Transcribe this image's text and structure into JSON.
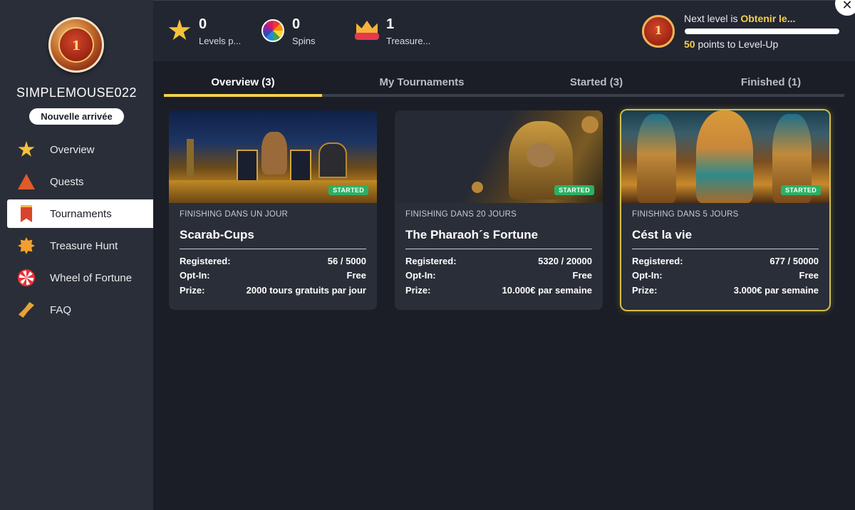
{
  "profile": {
    "avatar_level": "1",
    "username": "SIMPLEMOUSE022",
    "rank": "Nouvelle arrivée"
  },
  "nav": {
    "items": [
      {
        "label": "Overview",
        "icon": "star-icon"
      },
      {
        "label": "Quests",
        "icon": "quest-icon"
      },
      {
        "label": "Tournaments",
        "icon": "banner-icon",
        "active": true
      },
      {
        "label": "Treasure Hunt",
        "icon": "medal-icon"
      },
      {
        "label": "Wheel of Fortune",
        "icon": "wheel-icon"
      },
      {
        "label": "FAQ",
        "icon": "horn-icon"
      }
    ]
  },
  "stats": {
    "levels": {
      "value": "0",
      "label": "Levels p..."
    },
    "spins": {
      "value": "0",
      "label": "Spins"
    },
    "treasure": {
      "value": "1",
      "label": "Treasure..."
    }
  },
  "level": {
    "badge": "1",
    "next_prefix": "Next level is ",
    "next_name": "Obtenir le...",
    "progress_fraction": 0.0,
    "points": "50",
    "points_suffix": " points to Level-Up"
  },
  "close": {
    "glyph": "✕"
  },
  "tabs": [
    {
      "label": "Overview (3)",
      "active": true
    },
    {
      "label": "My Tournaments"
    },
    {
      "label": "Started (3)"
    },
    {
      "label": "Finished (1)"
    }
  ],
  "cards": [
    {
      "status": "STARTED",
      "subtitle": "FINISHING DANS UN JOUR",
      "title": "Scarab-Cups",
      "registered_label": "Registered:",
      "registered": "56 / 5000",
      "optin_label": "Opt-In:",
      "optin": "Free",
      "prize_label": "Prize:",
      "prize": "2000 tours gratuits par jour"
    },
    {
      "status": "STARTED",
      "subtitle": "FINISHING DANS 20 JOURS",
      "title": "The Pharaoh´s Fortune",
      "registered_label": "Registered:",
      "registered": "5320 / 20000",
      "optin_label": "Opt-In:",
      "optin": "Free",
      "prize_label": "Prize:",
      "prize": "10.000€ par semaine"
    },
    {
      "status": "STARTED",
      "subtitle": "FINISHING DANS 5 JOURS",
      "title": "Cést la vie",
      "registered_label": "Registered:",
      "registered": "677 / 50000",
      "optin_label": "Opt-In:",
      "optin": "Free",
      "prize_label": "Prize:",
      "prize": "3.000€ par semaine",
      "highlighted": true
    }
  ],
  "colors": {
    "accent": "#f5d04a",
    "status_green": "#2bb163",
    "sidebar": "#2a2e38",
    "background": "#1b1e26"
  }
}
